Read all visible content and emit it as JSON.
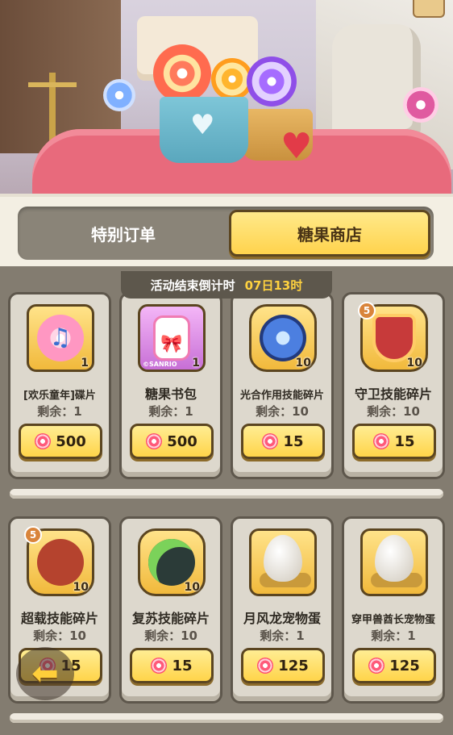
{
  "tabs": [
    {
      "label": "特别订单",
      "active": false
    },
    {
      "label": "糖果商店",
      "active": true
    }
  ],
  "countdown": {
    "label": "活动结束倒计时",
    "time": "07日13时"
  },
  "currency_icon": "candy-icon",
  "accent_color": "#ffd44a",
  "items": [
    {
      "name": "[欢乐童年]碟片",
      "stock": "剩余：1",
      "count": "1",
      "price": "500",
      "icon": "music-disc-icon"
    },
    {
      "name": "糖果书包",
      "stock": "剩余：1",
      "count": "1",
      "price": "500",
      "icon": "candy-backpack-icon",
      "brand": "©SANRIO"
    },
    {
      "name": "光合作用技能碎片",
      "stock": "剩余：10",
      "count": "10",
      "price": "15",
      "icon": "photosynthesis-skill-icon"
    },
    {
      "name": "守卫技能碎片",
      "stock": "剩余：10",
      "count": "10",
      "price": "15",
      "icon": "guard-skill-icon",
      "level": "5"
    },
    {
      "name": "超载技能碎片",
      "stock": "剩余：10",
      "count": "10",
      "price": "15",
      "icon": "overload-skill-icon",
      "level": "5"
    },
    {
      "name": "复苏技能碎片",
      "stock": "剩余：10",
      "count": "10",
      "price": "15",
      "icon": "revive-skill-icon"
    },
    {
      "name": "月风龙宠物蛋",
      "stock": "剩余：1",
      "count": "",
      "price": "125",
      "icon": "pet-egg-icon"
    },
    {
      "name": "穿甲兽酋长宠物蛋",
      "stock": "剩余：1",
      "count": "",
      "price": "125",
      "icon": "pet-egg-icon"
    }
  ]
}
